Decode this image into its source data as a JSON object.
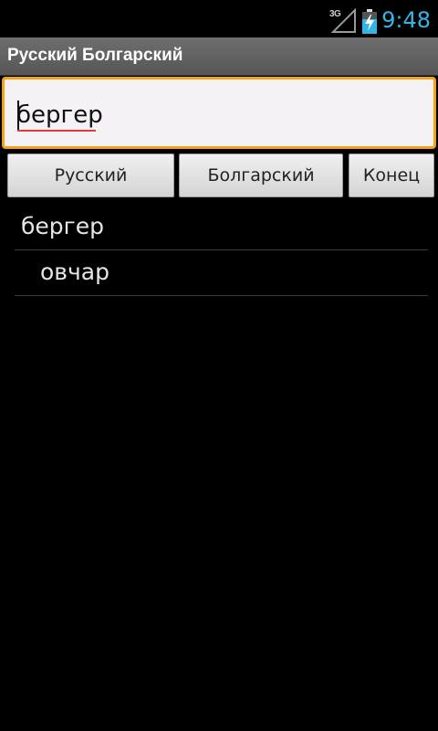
{
  "status_bar": {
    "network": "3G",
    "time": "9:48",
    "colors": {
      "clock": "#33b5e5"
    }
  },
  "app": {
    "title": "Русский Болгарский"
  },
  "search": {
    "value": "бергер"
  },
  "buttons": {
    "russian": "Русский",
    "bulgarian": "Болгарский",
    "exit": "Конец"
  },
  "results": [
    {
      "text": "бергер"
    },
    {
      "text": "овчар"
    }
  ],
  "colors": {
    "search_border": "#f4a21b",
    "spellcheck_underline": "#e63b3b",
    "title_bar": "#616161"
  }
}
